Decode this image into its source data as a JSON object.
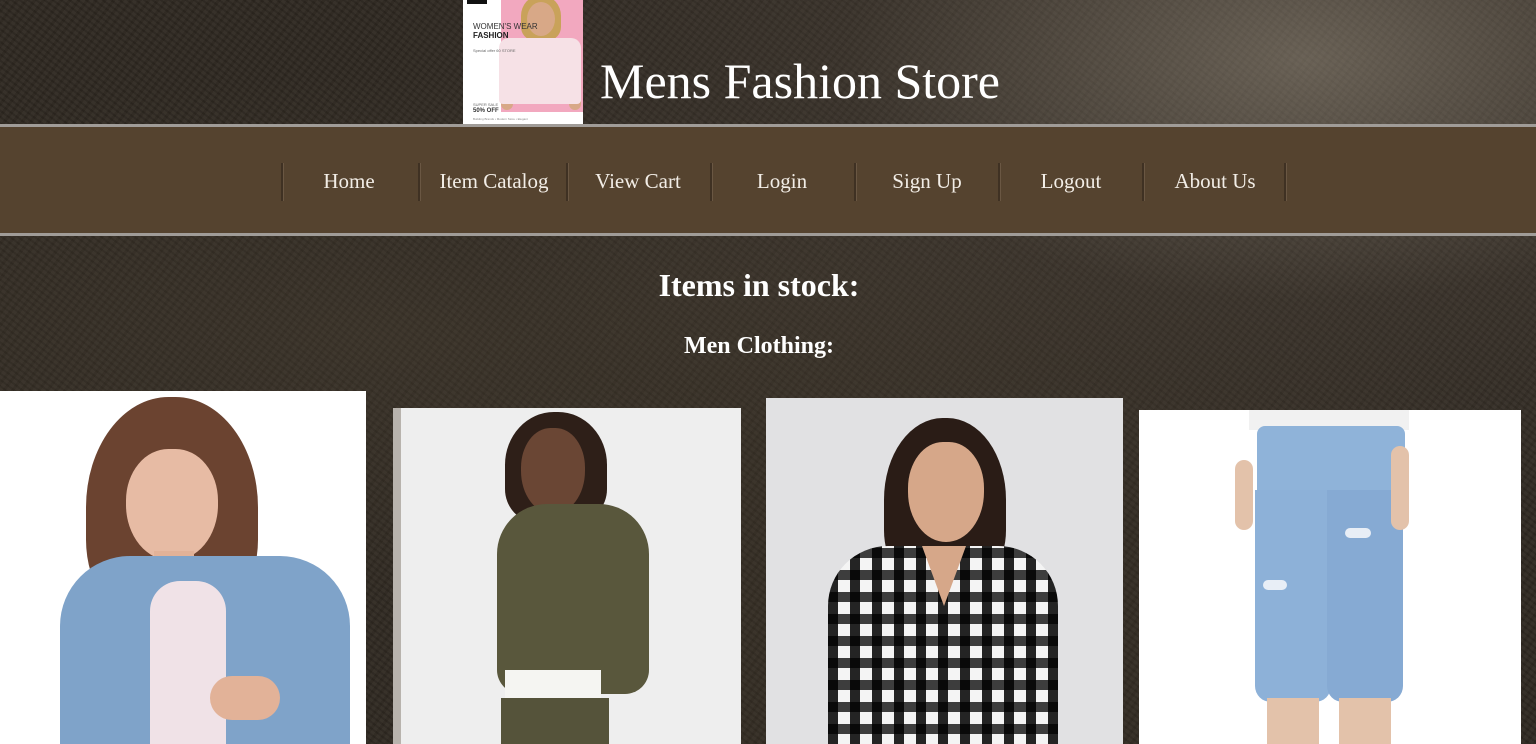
{
  "header": {
    "logo": {
      "line1": "WOMEN'S WEAR",
      "line2": "FASHION",
      "line3": "Special offer 60 STORE",
      "line4": "SUPER SALE",
      "line5": "50% OFF",
      "line6": "Building Brands • Modern Store • Elegant"
    },
    "title": "Mens Fashion Store"
  },
  "nav": {
    "items": [
      {
        "label": "Home"
      },
      {
        "label": "Item Catalog"
      },
      {
        "label": "View Cart"
      },
      {
        "label": "Login"
      },
      {
        "label": "Sign Up"
      },
      {
        "label": "Logout"
      },
      {
        "label": "About Us"
      }
    ]
  },
  "main": {
    "stock_heading": "Items in stock:",
    "category_heading": "Men Clothing:"
  },
  "products": [
    {
      "image": "denim-jacket-photo"
    },
    {
      "image": "olive-hoodie-photo"
    },
    {
      "image": "plaid-shirt-photo"
    },
    {
      "image": "ripped-jeans-photo"
    }
  ],
  "colors": {
    "nav_background": "#55432f",
    "nav_border": "#a09c98",
    "heading_text": "#ffffff"
  }
}
